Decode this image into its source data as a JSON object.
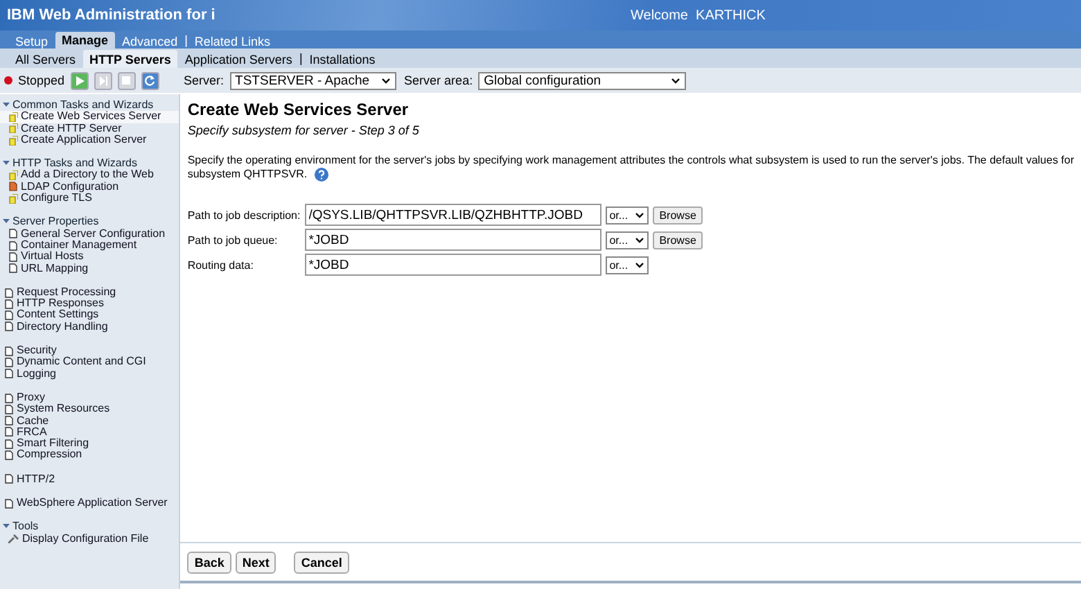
{
  "header": {
    "title": "IBM Web Administration for i",
    "welcome": "Welcome  KARTHICK"
  },
  "main_tabs": [
    {
      "label": "Setup",
      "selected": false
    },
    {
      "label": "Manage",
      "selected": true
    },
    {
      "label": "Advanced",
      "selected": false
    },
    {
      "label": "Related Links",
      "selected": false,
      "separator": "|"
    }
  ],
  "sub_tabs": [
    {
      "label": "All Servers",
      "selected": false
    },
    {
      "label": "HTTP Servers",
      "selected": true
    },
    {
      "label": "Application Servers",
      "selected": false
    },
    {
      "label": "Installations",
      "selected": false,
      "separator": "|"
    }
  ],
  "toolbar": {
    "status": "Stopped",
    "running": false,
    "actions": [
      {
        "kind": "start",
        "disabled": false
      },
      {
        "kind": "restart",
        "disabled": true
      },
      {
        "kind": "stop",
        "disabled": true
      },
      {
        "kind": "refresh",
        "disabled": false
      }
    ],
    "server_label": "Server:",
    "server_value": "TSTSERVER - Apache",
    "area_label": "Server area:",
    "area_value": "Global configuration"
  },
  "sidebar": [
    {
      "title": "Common Tasks and Wizards",
      "expanded": true,
      "items": [
        {
          "label": "Create Web Services Server",
          "kind": "wizard",
          "selected": true
        },
        {
          "label": "Create HTTP Server",
          "kind": "wizard",
          "selected": false
        },
        {
          "label": "Create Application Server",
          "kind": "wizard",
          "selected": false
        }
      ]
    },
    {
      "title": "HTTP Tasks and Wizards",
      "expanded": true,
      "items": [
        {
          "label": "Add a Directory to the Web",
          "kind": "wizard",
          "selected": false
        },
        {
          "label": "LDAP Configuration",
          "kind": "ldap",
          "selected": false
        },
        {
          "label": "Configure TLS",
          "kind": "wizard",
          "selected": false
        }
      ]
    },
    {
      "title": "Server Properties",
      "expanded": true,
      "items": [
        {
          "label": "General Server Configuration",
          "kind": "page",
          "selected": false
        },
        {
          "label": "Container Management",
          "kind": "page",
          "selected": false
        },
        {
          "label": "Virtual Hosts",
          "kind": "page",
          "selected": false
        },
        {
          "label": "URL Mapping",
          "kind": "page",
          "selected": false
        }
      ]
    },
    {
      "items": [
        {
          "label": "Request Processing",
          "kind": "page",
          "selected": false
        },
        {
          "label": "HTTP Responses",
          "kind": "page",
          "selected": false
        },
        {
          "label": "Content Settings",
          "kind": "page",
          "selected": false
        },
        {
          "label": "Directory Handling",
          "kind": "page",
          "selected": false
        }
      ]
    },
    {
      "items": [
        {
          "label": "Security",
          "kind": "page",
          "selected": false
        },
        {
          "label": "Dynamic Content and CGI",
          "kind": "page",
          "selected": false
        },
        {
          "label": "Logging",
          "kind": "page",
          "selected": false
        }
      ]
    },
    {
      "items": [
        {
          "label": "Proxy",
          "kind": "page",
          "selected": false
        },
        {
          "label": "System Resources",
          "kind": "page",
          "selected": false
        },
        {
          "label": "Cache",
          "kind": "page",
          "selected": false
        },
        {
          "label": "FRCA",
          "kind": "page",
          "selected": false
        },
        {
          "label": "Smart Filtering",
          "kind": "page",
          "selected": false
        },
        {
          "label": "Compression",
          "kind": "page",
          "selected": false
        }
      ]
    },
    {
      "items": [
        {
          "label": "HTTP/2",
          "kind": "page",
          "selected": false
        }
      ]
    },
    {
      "items": [
        {
          "label": "WebSphere Application Server",
          "kind": "page",
          "selected": false
        }
      ]
    },
    {
      "title": "Tools",
      "expanded": true,
      "items": [
        {
          "label": "Display Configuration File",
          "kind": "tool",
          "selected": false
        }
      ]
    }
  ],
  "content": {
    "title": "Create Web Services Server",
    "subtitle": "Specify subsystem for server - Step 3 of 5",
    "description_lines": [
      "Specify the operating environment for the server's jobs by specifying work management attributes the controls what subsystem is used to run the server's jobs. The default values for",
      "subsystem QHTTPSVR."
    ],
    "fields": [
      {
        "label": "Path to job description:",
        "value": "/QSYS.LIB/QHTTPSVR.LIB/QZHBHTTP.JOBD",
        "option": "or...",
        "browse": "Browse"
      },
      {
        "label": "Path to job queue:",
        "value": "*JOBD",
        "option": "or...",
        "browse": "Browse"
      },
      {
        "label": "Routing data:",
        "value": "*JOBD",
        "option": "or..."
      }
    ],
    "buttons": [
      "Back",
      "Next",
      "Cancel"
    ]
  }
}
